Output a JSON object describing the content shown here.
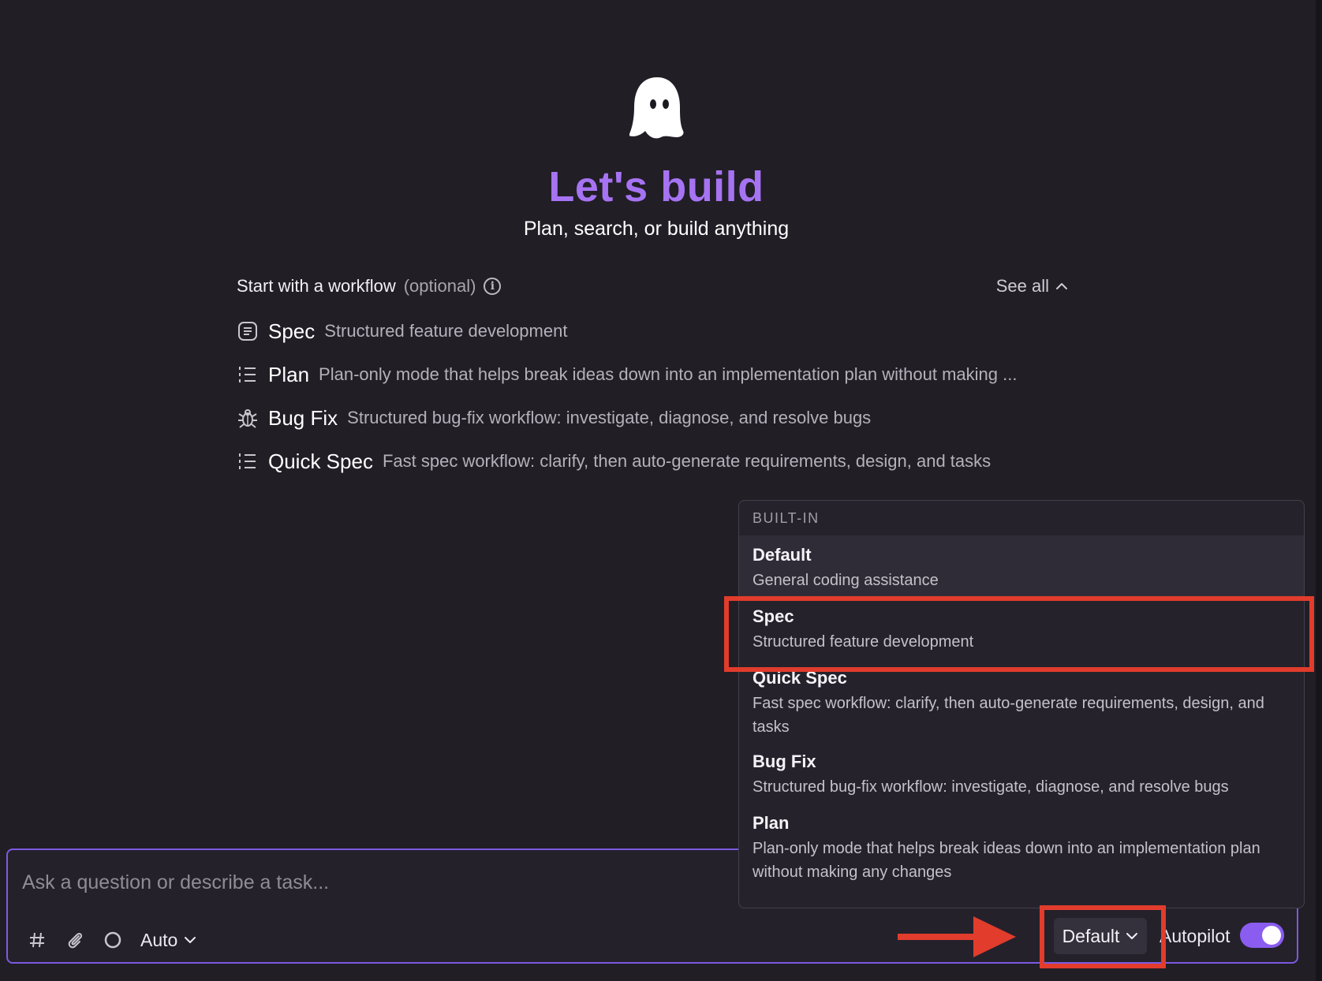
{
  "hero": {
    "title": "Let's build",
    "subtitle": "Plan, search, or build anything",
    "logo_icon": "ghost-icon"
  },
  "workflows": {
    "label": "Start with a workflow",
    "optional": "(optional)",
    "see_all": "See all",
    "items": [
      {
        "name": "Spec",
        "description": "Structured feature development",
        "icon": "document-lines-icon"
      },
      {
        "name": "Plan",
        "description": "Plan-only mode that helps break ideas down into an implementation plan without making ...",
        "icon": "numbered-list-icon"
      },
      {
        "name": "Bug Fix",
        "description": "Structured bug-fix workflow: investigate, diagnose, and resolve bugs",
        "icon": "bug-icon"
      },
      {
        "name": "Quick Spec",
        "description": "Fast spec workflow: clarify, then auto-generate requirements, design, and tasks",
        "icon": "numbered-list-icon"
      }
    ]
  },
  "dropdown": {
    "section": "BUILT-IN",
    "selected_index": 0,
    "items": [
      {
        "title": "Default",
        "description": "General coding assistance"
      },
      {
        "title": "Spec",
        "description": "Structured feature development"
      },
      {
        "title": "Quick Spec",
        "description": "Fast spec workflow: clarify, then auto-generate requirements, design, and tasks"
      },
      {
        "title": "Bug Fix",
        "description": "Structured bug-fix workflow: investigate, diagnose, and resolve bugs"
      },
      {
        "title": "Plan",
        "description": "Plan-only mode that helps break ideas down into an implementation plan without making any changes"
      }
    ]
  },
  "input": {
    "placeholder": "Ask a question or describe a task...",
    "value": ""
  },
  "toolbar": {
    "model": "Auto",
    "mode": "Default",
    "autopilot_label": "Autopilot",
    "autopilot_on": true
  },
  "colors": {
    "background": "#211e26",
    "accent": "#a673f2",
    "toggle": "#8a5df0",
    "annotation": "#e13c2c"
  }
}
